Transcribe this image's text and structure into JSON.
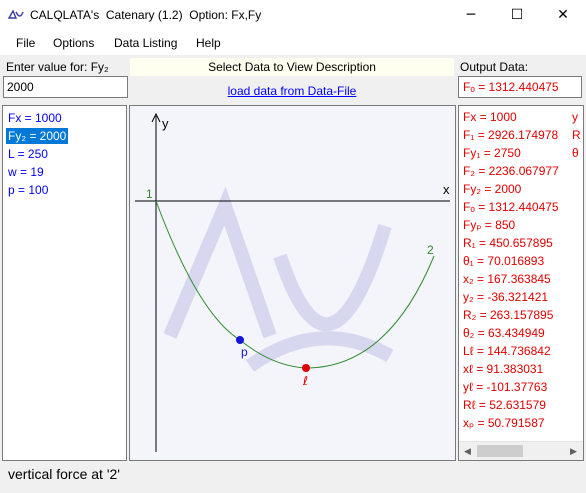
{
  "window": {
    "icon": "calqlata-logo-icon",
    "title": "CALQLATA's  Catenary (1.2)  Option: Fx,Fy",
    "minimize_glyph": "─",
    "maximize_glyph": "☐",
    "close_glyph": "✕"
  },
  "menu": [
    "File",
    "Options",
    "Data Listing",
    "Help"
  ],
  "input": {
    "label": "Enter value for: Fy₂",
    "value": "2000"
  },
  "description": {
    "prompt": "Select Data to View Description",
    "link": "load data from Data-File"
  },
  "output": {
    "label": "Output Data:",
    "value": "Fₒ = 1312.440475"
  },
  "inputs": [
    {
      "text": "Fx = 1000",
      "selected": false
    },
    {
      "text": "Fy₂ = 2000",
      "selected": true
    },
    {
      "text": "L = 250",
      "selected": false
    },
    {
      "text": "w = 19",
      "selected": false
    },
    {
      "text": "p = 100",
      "selected": false
    }
  ],
  "outputs": [
    "Fx = 1000",
    "F₁ = 2926.174978",
    "Fy₁ = 2750",
    "F₂ = 2236.067977",
    "Fy₂ = 2000",
    "Fₒ = 1312.440475",
    "Fyₚ = 850",
    "R₁ = 450.657895",
    "θ₁ = 70.016893",
    "x₂ = 167.363845",
    "y₂ = -36.321421",
    "R₂ = 263.157895",
    "θ₂ = 63.434949",
    "Lℓ = 144.736842",
    "xℓ = 91.383031",
    "yℓ = -101.37763",
    "Rℓ = 52.631579",
    "xₚ = 50.791587"
  ],
  "outputs_clipped": [
    "y",
    "R",
    "θ"
  ],
  "diagram": {
    "x_label": "x",
    "y_label": "y",
    "point1_label": "1",
    "point2_label": "2",
    "p_label": "p",
    "l_label": "ℓ",
    "curve_color": "#2e8b2e",
    "p_color": "#1414d4",
    "l_color": "#e00000",
    "axis_color": "#000000",
    "watermark_color": "#c8cae8"
  },
  "scrollbar": {
    "left_glyph": "◀",
    "right_glyph": "▶"
  },
  "status": "vertical force at '2'"
}
